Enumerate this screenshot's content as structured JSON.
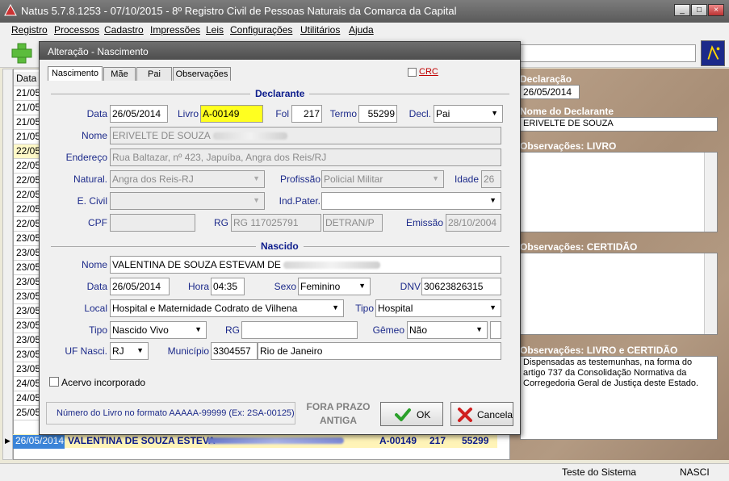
{
  "window": {
    "title": "Natus 5.7.8.1253 - 07/10/2015 - 8º Registro Civil de Pessoas Naturais da Comarca da Capital",
    "min_label": "_",
    "max_label": "□",
    "close_label": "×"
  },
  "menu": [
    "Registro",
    "Processos",
    "Cadastro",
    "Impressões",
    "Leis",
    "Configurações",
    "Utilitários",
    "Ajuda"
  ],
  "grid": {
    "header_date": "Data",
    "dates": [
      "21/05",
      "21/05",
      "21/05",
      "21/05",
      "22/05",
      "22/05",
      "22/05",
      "22/05",
      "22/05",
      "22/05",
      "23/05",
      "23/05",
      "23/05",
      "23/05",
      "23/05",
      "23/05",
      "23/05",
      "23/05",
      "23/05",
      "23/05",
      "24/05",
      "24/05",
      "25/05"
    ],
    "selected": {
      "date": "26/05/2014",
      "name": "VALENTINA DE SOUZA ESTEVA",
      "livro": "A-00149",
      "folha": "217",
      "termo": "55299"
    }
  },
  "right_panel": {
    "declaracao_label": "Declaração",
    "declaracao_value": "26/05/2014",
    "nome_declarante_label": "Nome do Declarante",
    "nome_declarante_value": "ERIVELTE DE SOUZA",
    "obs_livro_label": "Observações: LIVRO",
    "obs_certidao_label": "Observações: CERTIDÃO",
    "obs_livro_certidao_label": "Observações: LIVRO e CERTIDÃO",
    "obs_livro_certidao_value": "Dispensadas as testemunhas, na forma do artigo 737 da Consolidação Normativa da Corregedoria Geral de Justiça deste Estado."
  },
  "status": {
    "user": "Teste do Sistema",
    "module": "NASCI"
  },
  "dialog": {
    "title": "Alteração - Nascimento",
    "tabs": [
      "Nascimento",
      "Mãe",
      "Pai",
      "Observações"
    ],
    "crc_label": "CRC",
    "declarante": {
      "section": "Declarante",
      "data_label": "Data",
      "data": "26/05/2014",
      "livro_label": "Livro",
      "livro": "A-00149",
      "fol_label": "Fol",
      "fol": "217",
      "termo_label": "Termo",
      "termo": "55299",
      "decl_label": "Decl.",
      "decl": "Pai",
      "nome_label": "Nome",
      "nome": "ERIVELTE DE SOUZA",
      "endereco_label": "Endereço",
      "endereco": "Rua Baltazar, nº 423, Japuíba, Angra dos Reis/RJ",
      "natural_label": "Natural.",
      "natural": "Angra dos Reis-RJ",
      "profissao_label": "Profissão",
      "profissao": "Policial Militar",
      "idade_label": "Idade",
      "idade": "26",
      "ecivil_label": "E. Civil",
      "ecivil": "",
      "indpater_label": "Ind.Pater.",
      "indpater": "",
      "cpf_label": "CPF",
      "cpf": "",
      "rg_label": "RG",
      "rg": "RG 117025791",
      "orgao": "DETRAN/P",
      "emissao_label": "Emissão",
      "emissao": "28/10/2004"
    },
    "nascido": {
      "section": "Nascido",
      "nome_label": "Nome",
      "nome": "VALENTINA DE SOUZA ESTEVAM DE",
      "data_label": "Data",
      "data": "26/05/2014",
      "hora_label": "Hora",
      "hora": "04:35",
      "sexo_label": "Sexo",
      "sexo": "Feminino",
      "dnv_label": "DNV",
      "dnv": "30623826315",
      "local_label": "Local",
      "local": "Hospital e Maternidade Codrato de Vilhena",
      "tipo_local_label": "Tipo",
      "tipo_local": "Hospital",
      "tipo_label": "Tipo",
      "tipo": "Nascido Vivo",
      "rg_label": "RG",
      "rg": "",
      "gemeo_label": "Gêmeo",
      "gemeo": "Não",
      "uf_label": "UF Nasci.",
      "uf": "RJ",
      "municipio_label": "Município",
      "municipio_code": "3304557",
      "municipio": "Rio de Janeiro"
    },
    "acervo_label": "Acervo incorporado",
    "hint": "Número do Livro no formato AAAAA-99999  (Ex: 2SA-00125)",
    "fora_prazo": "FORA PRAZO ANTIGA",
    "ok_label": "OK",
    "cancel_label": "Cancela"
  }
}
